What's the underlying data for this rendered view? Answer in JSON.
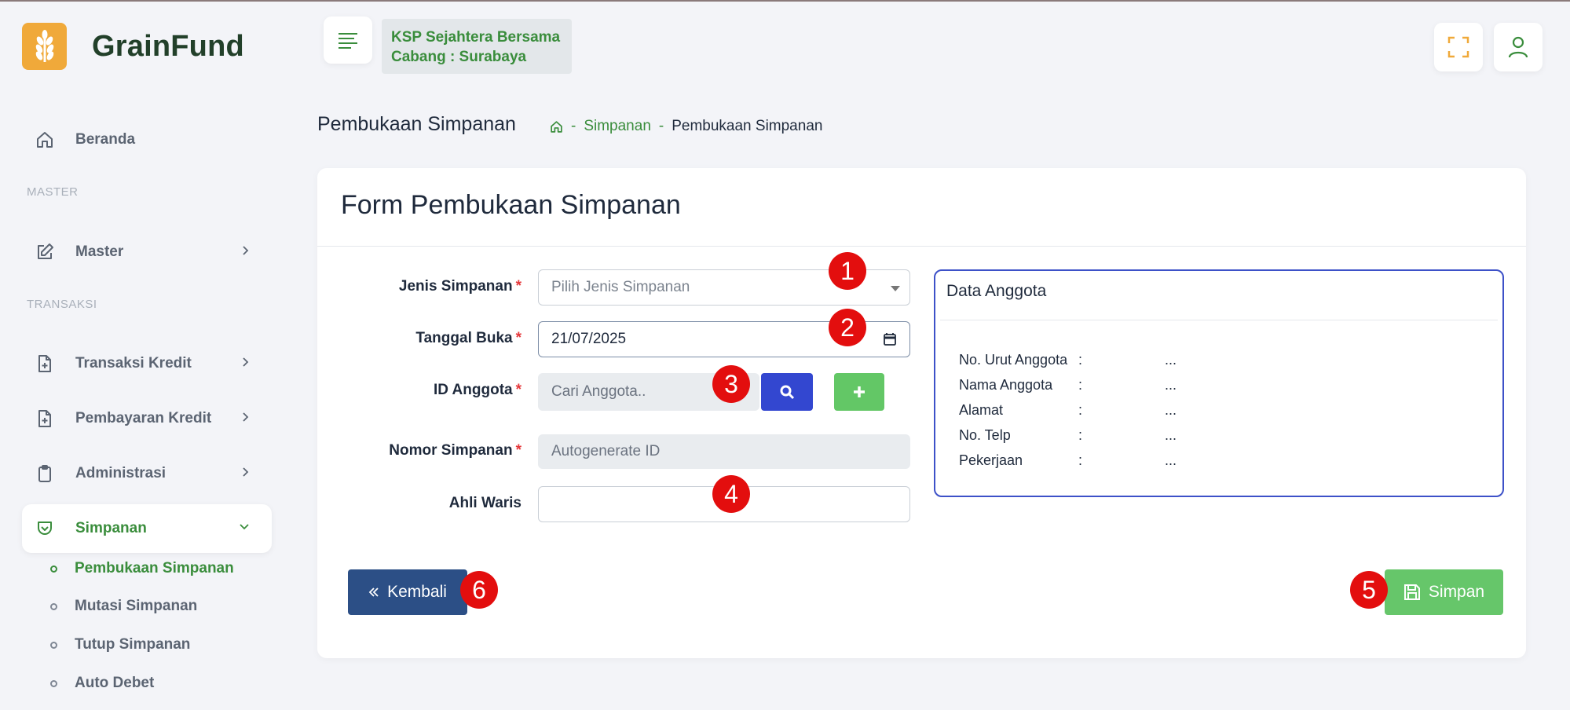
{
  "brand": {
    "name": "GrainFund",
    "logo_icon": "wheat-icon"
  },
  "header": {
    "branch_name": "KSP Sejahtera Bersama",
    "branch_city": "Cabang : Surabaya",
    "fullscreen_icon": "fullscreen-icon",
    "user_icon": "user-icon"
  },
  "sidebar": {
    "home": "Beranda",
    "section_master": "MASTER",
    "master": "Master",
    "section_transaksi": "TRANSAKSI",
    "transaksi_kredit": "Transaksi Kredit",
    "pembayaran_kredit": "Pembayaran Kredit",
    "administrasi": "Administrasi",
    "simpanan": "Simpanan",
    "sub": [
      "Pembukaan Simpanan",
      "Mutasi Simpanan",
      "Tutup Simpanan",
      "Auto Debet"
    ]
  },
  "page": {
    "title": "Pembukaan Simpanan",
    "breadcrumb": {
      "sep": "-",
      "parent": "Simpanan",
      "current": "Pembukaan Simpanan"
    }
  },
  "form": {
    "title": "Form Pembukaan Simpanan",
    "required_mark": "*",
    "jenis_label": "Jenis Simpanan",
    "jenis_placeholder": "Pilih Jenis Simpanan",
    "tanggal_label": "Tanggal Buka",
    "tanggal_value": "21/07/2025",
    "id_label": "ID Anggota",
    "id_placeholder": "Cari Anggota..",
    "nomor_label": "Nomor Simpanan",
    "nomor_value": "Autogenerate ID",
    "ahli_label": "Ahli Waris",
    "ahli_value": "",
    "back_label": "Kembali",
    "save_label": "Simpan"
  },
  "member": {
    "title": "Data Anggota",
    "rows": [
      {
        "key": "No. Urut Anggota",
        "colon": ":",
        "value": "..."
      },
      {
        "key": "Nama Anggota",
        "colon": ":",
        "value": "..."
      },
      {
        "key": "Alamat",
        "colon": ":",
        "value": "..."
      },
      {
        "key": "No. Telp",
        "colon": ":",
        "value": "..."
      },
      {
        "key": "Pekerjaan",
        "colon": ":",
        "value": "..."
      }
    ]
  },
  "markers": [
    "1",
    "2",
    "3",
    "4",
    "5",
    "6"
  ],
  "colors": {
    "brand_green": "#3a8d3c",
    "primary_blue": "#3347d0",
    "navy": "#2c4f86",
    "success_green": "#66c66a",
    "marker_red": "#e30e0e",
    "logo_orange": "#f0a93a"
  }
}
